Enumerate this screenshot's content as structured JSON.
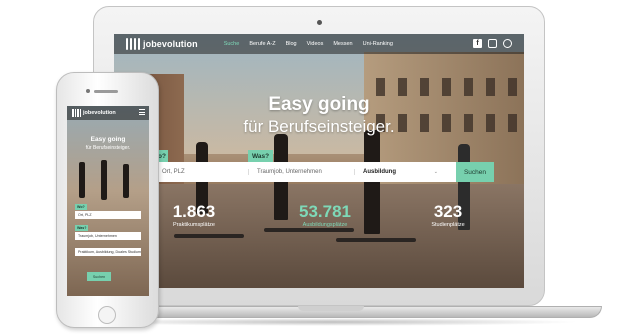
{
  "laptop": {
    "nav": {
      "logo_text": "jobevolution",
      "links": [
        "Suche",
        "Berufe A-Z",
        "Blog",
        "Videos",
        "Messen",
        "Uni-Ranking"
      ],
      "active_link": "Suche",
      "icons": [
        "facebook-icon",
        "instagram-icon",
        "user-icon"
      ]
    },
    "hero": {
      "title": "Easy going",
      "subtitle": "für Berufseinsteiger."
    },
    "search": {
      "tag_where": "Wo?",
      "tag_what": "Was?",
      "where_placeholder": "Ort, PLZ",
      "what_placeholder": "Traumjob, Unternehmen",
      "select_value": "Ausbildung",
      "button_label": "Suchen"
    },
    "stats": [
      {
        "value": "1.863",
        "label": "Praktikumsplätze"
      },
      {
        "value": "53.781",
        "label": "Ausbildungsplätze"
      },
      {
        "value": "323",
        "label": "Studienplätze"
      }
    ]
  },
  "phone": {
    "nav": {
      "logo_text": "jobevolution"
    },
    "hero": {
      "title": "Easy going",
      "subtitle": "für Berufseinsteiger."
    },
    "search": {
      "tag_where": "Wo?",
      "tag_what": "Was?",
      "where_value": "Ort, PLZ",
      "what_value": "Traumjob, Unternehmen",
      "select_value": "Praktikum, Ausbildung, Duales Studium",
      "button_label": "Suchen"
    }
  },
  "colors": {
    "accent": "#77d0ae",
    "accent_text": "#7ed9b8",
    "nav_bg": "#232323"
  }
}
